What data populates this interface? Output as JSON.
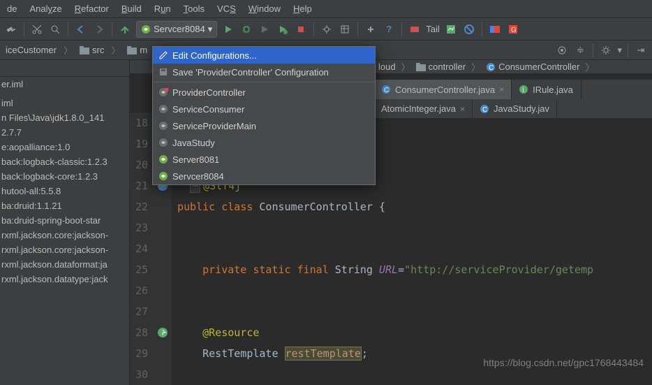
{
  "menu": {
    "items": [
      "de",
      "Analyze",
      "Refactor",
      "Build",
      "Run",
      "Tools",
      "VCS",
      "Window",
      "Help"
    ],
    "underlines": [
      null,
      3,
      0,
      0,
      1,
      0,
      2,
      0,
      0
    ]
  },
  "toolbar": {
    "runconfig_label": "Servcer8084"
  },
  "breadcrumbs": {
    "items": [
      "iceCustomer",
      "src",
      "m",
      "loud",
      "controller",
      "ConsumerController"
    ],
    "icons": [
      null,
      "folder-icon",
      "folder-icon",
      "folder-icon",
      "folder-icon",
      "class-icon"
    ]
  },
  "popup": {
    "items": [
      {
        "label": "Edit Configurations...",
        "icon": "pencil-icon",
        "selected": true
      },
      {
        "label": "Save 'ProviderController' Configuration",
        "icon": "disk-icon"
      }
    ],
    "configs": [
      {
        "label": "ProviderController",
        "icon": "spring-stop-icon"
      },
      {
        "label": "ServiceConsumer",
        "icon": "spring-icon"
      },
      {
        "label": "ServiceProviderMain",
        "icon": "spring-icon"
      },
      {
        "label": "JavaStudy",
        "icon": "spring-icon"
      },
      {
        "label": "Server8081",
        "icon": "spring-run-icon"
      },
      {
        "label": "Servcer8084",
        "icon": "spring-run-icon"
      }
    ]
  },
  "project": {
    "items": [
      "er.iml",
      "",
      "iml",
      "n Files\\Java\\jdk1.8.0_141",
      "2.7.7",
      "e:aopalliance:1.0",
      "back:logback-classic:1.2.3",
      "back:logback-core:1.2.3",
      "hutool-all:5.5.8",
      "ba:druid:1.1.21",
      "ba:druid-spring-boot-star",
      "rxml.jackson.core:jackson-",
      "rxml.jackson.core:jackson-",
      "rxml.jackson.dataformat:ja",
      "rxml.jackson.datatype:jack"
    ]
  },
  "tabs": {
    "row1": [
      {
        "label": "ConsumerController.java",
        "icon": "class-icon",
        "active": true,
        "closable": true
      },
      {
        "label": "IRule.java",
        "icon": "interface-icon"
      }
    ],
    "row2": [
      {
        "label": "AtomicInteger.java",
        "closable": true
      },
      {
        "label": "JavaStudy.jav",
        "icon": "class-icon"
      }
    ]
  },
  "gutter": {
    "start": 18,
    "lines": 13,
    "icons": {
      "21": "run-marker",
      "28": "nav-marker"
    }
  },
  "code": {
    "lines": [
      "",
      "",
      "",
      {
        "tokens": [
          [
            "  ",
            null
          ],
          [
            "-",
            "fold"
          ],
          [
            "@Slf4j",
            "anno"
          ]
        ]
      },
      {
        "tokens": [
          [
            "public ",
            "key"
          ],
          [
            "class ",
            "key"
          ],
          [
            "ConsumerController",
            "type"
          ],
          [
            " {",
            "type"
          ]
        ]
      },
      "",
      "",
      {
        "tokens": [
          [
            "    private static final ",
            "key"
          ],
          [
            "String ",
            "type"
          ],
          [
            "URL",
            "ital"
          ],
          [
            "=",
            "type"
          ],
          [
            "\"http://serviceProvider/getemp",
            "str"
          ]
        ]
      },
      "",
      "",
      {
        "tokens": [
          [
            "    @Resource",
            "anno"
          ]
        ]
      },
      {
        "tokens": [
          [
            "    RestTemplate ",
            "type"
          ],
          [
            "restTemplate",
            "field-hl"
          ],
          [
            ";",
            "type"
          ]
        ]
      },
      ""
    ]
  },
  "watermark": "https://blog.csdn.net/gpc1768443484"
}
